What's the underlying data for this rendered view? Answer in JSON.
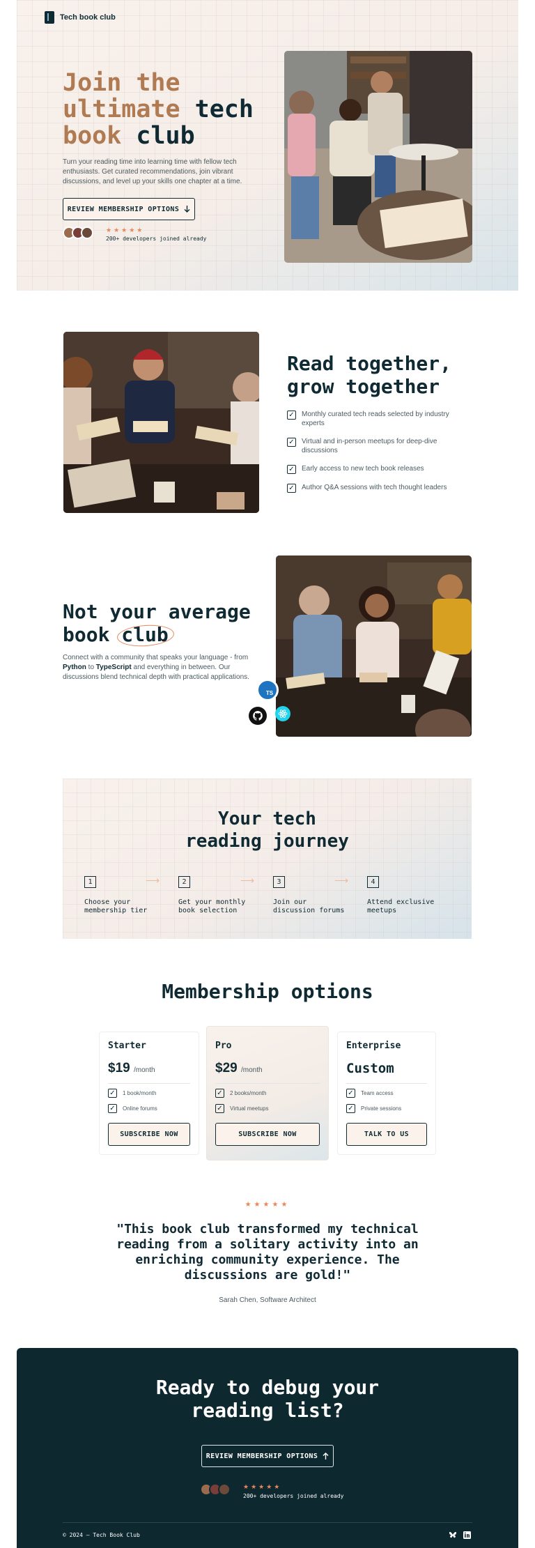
{
  "brand": {
    "name": "Tech book club"
  },
  "hero": {
    "title_accent": "Join the",
    "title_accent_2": "ultimate",
    "title_rest": "tech",
    "title_accent_3": "book",
    "title_rest_2": "club",
    "description": "Turn your reading time into learning time with fellow tech enthusiasts. Get curated recommendations, join vibrant discussions, and level up your skills one chapter at a time.",
    "cta_label": "REVIEW MEMBERSHIP OPTIONS",
    "rating_stars": "★★★★★",
    "joined_text": "200+ developers joined already"
  },
  "read_together": {
    "title_line1": "Read together,",
    "title_line2": "grow together",
    "items": [
      "Monthly curated tech reads selected by industry experts",
      "Virtual and in-person meetups for deep-dive discussions",
      "Early access to new tech book releases",
      "Author Q&A sessions with tech thought leaders"
    ]
  },
  "average": {
    "title_line1": "Not your average",
    "title_book": "book",
    "title_club": "club",
    "desc_part1": "Connect with a community that speaks your language - from ",
    "desc_python": "Python",
    "desc_to": " to ",
    "desc_typescript": "TypeScript",
    "desc_part2": " and everything in between. Our discussions blend technical depth with practical applications.",
    "ts_badge": "TS"
  },
  "journey": {
    "title_line1": "Your tech",
    "title_line2": "reading journey",
    "steps": [
      {
        "num": "1",
        "label": "Choose your membership tier"
      },
      {
        "num": "2",
        "label": "Get your monthly book selection"
      },
      {
        "num": "3",
        "label": "Join our discussion forums"
      },
      {
        "num": "4",
        "label": "Attend exclusive meetups"
      }
    ]
  },
  "membership": {
    "title": "Membership options",
    "plans": [
      {
        "name": "Starter",
        "price": "$19",
        "period": "/month",
        "features": [
          "1 book/month",
          "Online forums"
        ],
        "button": "SUBSCRIBE NOW"
      },
      {
        "name": "Pro",
        "price": "$29",
        "period": "/month",
        "features": [
          "2 books/month",
          "Virtual meetups"
        ],
        "button": "SUBSCRIBE NOW"
      },
      {
        "name": "Enterprise",
        "price": "Custom",
        "period": "",
        "features": [
          "Team access",
          "Private sessions"
        ],
        "button": "TALK TO US"
      }
    ]
  },
  "testimonial": {
    "stars": "★★★★★",
    "quote": "\"This book club transformed my technical reading from a solitary activity into an enriching community experience. The discussions are gold!\"",
    "author": "Sarah Chen, Software Architect"
  },
  "cta": {
    "title_line1": "Ready to debug your",
    "title_line2": "reading list?",
    "button": "REVIEW MEMBERSHIP OPTIONS",
    "stars": "★★★★★",
    "joined_text": "200+ developers joined already"
  },
  "footer": {
    "copyright": "© 2024 — Tech Book Club",
    "icons": [
      "butterfly-icon",
      "linkedin-icon"
    ]
  },
  "colors": {
    "dark": "#0f2a33",
    "accent": "#b07a52",
    "orange": "#e8875a"
  }
}
